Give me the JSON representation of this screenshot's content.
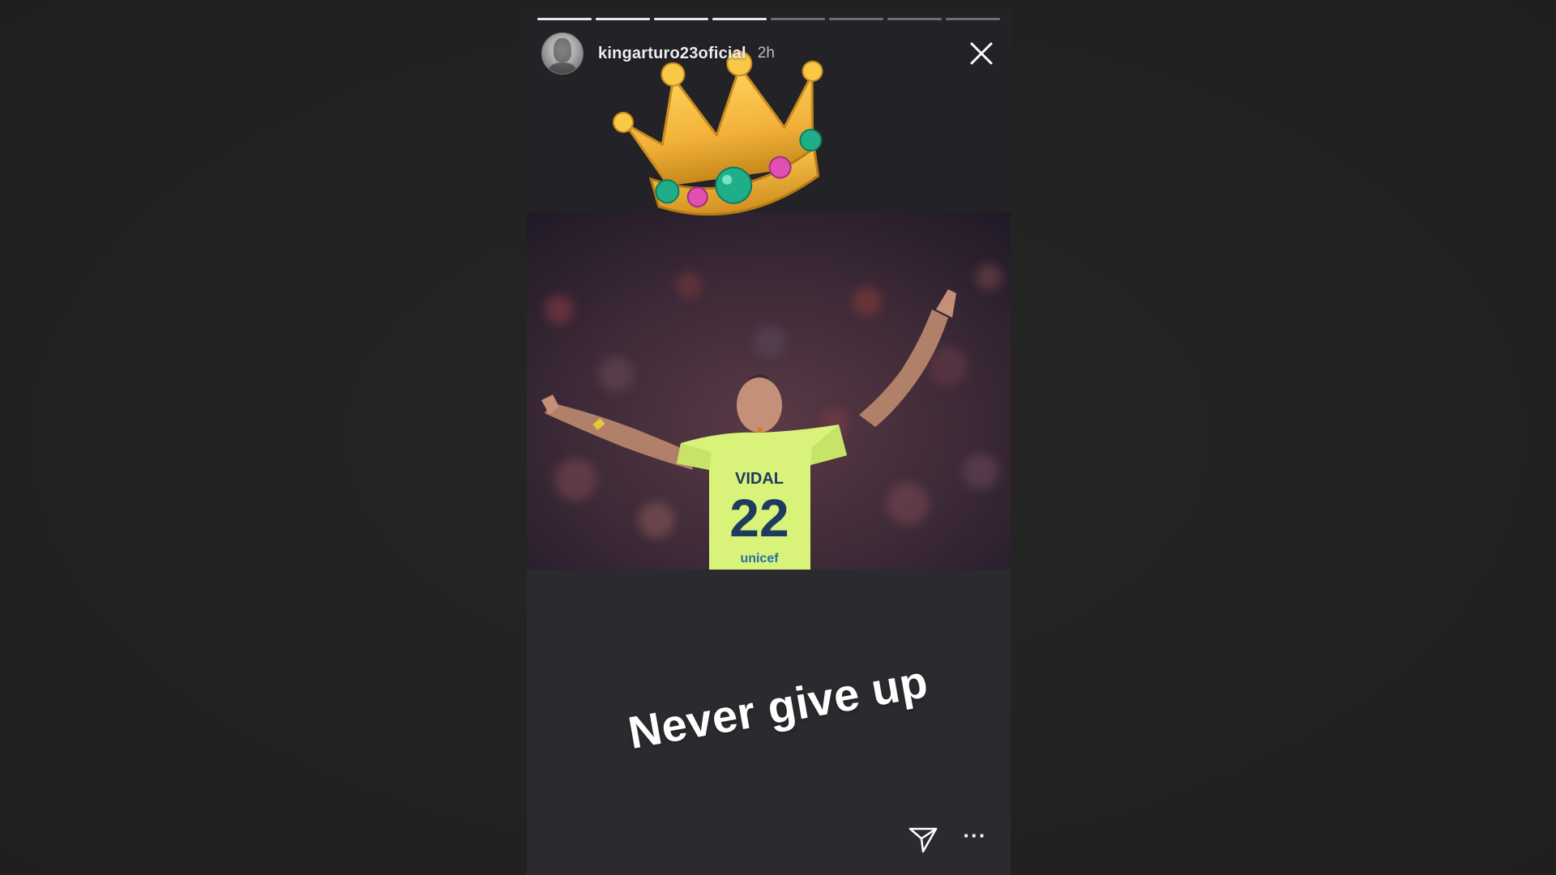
{
  "story": {
    "progress": {
      "segments": [
        1,
        1,
        1,
        1,
        0,
        0,
        0,
        0
      ]
    },
    "header": {
      "username": "kingarturo23oficial",
      "time": "2h",
      "avatar_icon": "profile-avatar",
      "close_icon": "close-icon"
    },
    "sticker": {
      "icon": "crown-emoji"
    },
    "photo": {
      "jersey_name": "VIDAL",
      "jersey_number": "22",
      "sponsor": "unicef"
    },
    "caption": "Never give up",
    "footer": {
      "send_icon": "send-icon",
      "more_label": "···"
    }
  },
  "colors": {
    "background": "#222222",
    "story_bg": "#2b2a2e",
    "jersey": "#d8f27a",
    "crown_gold": "#f2b23a",
    "gem_green": "#1fae8a",
    "gem_pink": "#e04fb2"
  }
}
